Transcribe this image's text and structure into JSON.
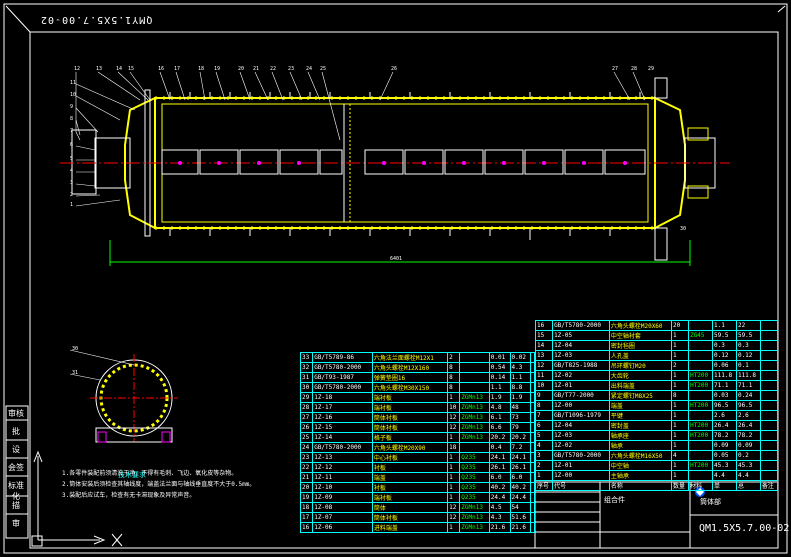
{
  "frame": {
    "title_rotated": "QMY1.5X5.7.00-02"
  },
  "side_labels": [
    "审核",
    "批",
    "设",
    "会签",
    "标准化",
    "描",
    "审"
  ],
  "main_view": {
    "overall_length_label": "6401"
  },
  "callouts_top": [
    "12",
    "13",
    "14",
    "15",
    "16",
    "17",
    "18",
    "19",
    "20",
    "21",
    "22",
    "23",
    "24",
    "25",
    "26",
    "27",
    "28",
    "29"
  ],
  "callouts_left": [
    "11",
    "10",
    "9",
    "8",
    "7",
    "6",
    "5",
    "4",
    "3",
    "2",
    "1"
  ],
  "section_callouts": [
    "30",
    "31"
  ],
  "right_callouts": [
    "28",
    "29",
    "30"
  ],
  "notes": {
    "title": "技术要求",
    "lines": [
      "1.各零件装配前须清洗干净，不得有毛刺、飞边、氧化皮等杂物。",
      "2.筒体安装后须检查其轴线度，端盖法兰面与轴线垂直度不大于0.5mm。",
      "3.装配后应试车，检查有无卡滞现象及异常声音。"
    ]
  },
  "parts_table_mid": {
    "rows": [
      [
        "33",
        "GB/T5789-86",
        "六角法兰面螺栓M12X1",
        "2",
        "",
        "0.01",
        "0.02",
        ""
      ],
      [
        "32",
        "GB/T5780-2000",
        "六角头螺栓M12X160",
        "8",
        "",
        "0.54",
        "4.3",
        ""
      ],
      [
        "31",
        "GB/T93-1987",
        "弹簧垫圈16",
        "8",
        "",
        "0.14",
        "1.1",
        ""
      ],
      [
        "30",
        "GB/T5780-2000",
        "六角头螺栓M30X150",
        "8",
        "",
        "1.1",
        "8.8",
        ""
      ],
      [
        "29",
        "1Z-18",
        "端衬板",
        "1",
        "ZGMn13",
        "1.9",
        "1.9",
        ""
      ],
      [
        "28",
        "1Z-17",
        "端衬板",
        "10",
        "ZGMn13",
        "4.8",
        "48",
        ""
      ],
      [
        "27",
        "1Z-16",
        "筒体衬板",
        "12",
        "ZGMn13",
        "6.1",
        "73",
        ""
      ],
      [
        "26",
        "1Z-15",
        "筒体衬板",
        "12",
        "ZGMn13",
        "6.6",
        "79",
        ""
      ],
      [
        "25",
        "1Z-14",
        "格子板",
        "1",
        "ZGMn13",
        "20.2",
        "20.2",
        ""
      ],
      [
        "24",
        "GB/T5780-2000",
        "六角头螺栓M20X90",
        "18",
        "",
        "0.4",
        "7.2",
        ""
      ],
      [
        "23",
        "1Z-13",
        "中心衬板",
        "1",
        "Q235",
        "24.1",
        "24.1",
        ""
      ],
      [
        "22",
        "1Z-12",
        "衬板",
        "1",
        "Q235",
        "26.1",
        "26.1",
        ""
      ],
      [
        "21",
        "1Z-11",
        "端盖",
        "1",
        "Q235",
        "6.0",
        "6.0",
        ""
      ],
      [
        "20",
        "1Z-10",
        "衬板",
        "1",
        "Q235",
        "40.2",
        "40.2",
        ""
      ],
      [
        "19",
        "1Z-09",
        "端衬板",
        "1",
        "Q235",
        "24.4",
        "24.4",
        ""
      ],
      [
        "18",
        "1Z-08",
        "筒体",
        "12",
        "ZGMn13",
        "4.5",
        "54",
        ""
      ],
      [
        "17",
        "1Z-07",
        "筒体衬板",
        "12",
        "ZGMn13",
        "4.3",
        "51.6",
        ""
      ],
      [
        "16",
        "1Z-06",
        "进料端盖",
        "1",
        "ZGMn13",
        "21.6",
        "21.6",
        ""
      ]
    ]
  },
  "parts_table_right": {
    "rows": [
      [
        "16",
        "GB/T5780-2000",
        "六角头螺栓M20X60",
        "20",
        "",
        "1.1",
        "22",
        ""
      ],
      [
        "15",
        "1Z-05",
        "中空轴衬套",
        "1",
        "ZG45",
        "59.5",
        "59.5",
        ""
      ],
      [
        "14",
        "1Z-04",
        "密封毡圈",
        "1",
        "",
        "0.3",
        "0.3",
        ""
      ],
      [
        "13",
        "1Z-03",
        "人孔盖",
        "1",
        "",
        "0.12",
        "0.12",
        ""
      ],
      [
        "12",
        "GB/T825-1988",
        "吊环螺钉M20",
        "2",
        "",
        "0.06",
        "0.1",
        ""
      ],
      [
        "11",
        "1Z-02",
        "大齿轮",
        "1",
        "HT200",
        "111.8",
        "111.8",
        ""
      ],
      [
        "10",
        "1Z-01",
        "出料端盖",
        "1",
        "HT200",
        "71.1",
        "71.1",
        ""
      ],
      [
        "9",
        "GB/T77-2000",
        "紧定螺钉M8X25",
        "8",
        "",
        "0.03",
        "0.24",
        ""
      ],
      [
        "8",
        "1Z-00",
        "端盖",
        "1",
        "HT200",
        "96.5",
        "96.5",
        ""
      ],
      [
        "7",
        "GB/T1096-1979",
        "平键",
        "1",
        "",
        "2.6",
        "2.6",
        ""
      ],
      [
        "6",
        "1Z-04",
        "密封盖",
        "1",
        "HT200",
        "26.4",
        "26.4",
        ""
      ],
      [
        "5",
        "1Z-03",
        "轴承座",
        "1",
        "HT200",
        "78.2",
        "78.2",
        ""
      ],
      [
        "4",
        "1Z-02",
        "轴承",
        "1",
        "",
        "0.09",
        "0.09",
        ""
      ],
      [
        "3",
        "GB/T5780-2000",
        "六角头螺栓M16X50",
        "4",
        "",
        "0.05",
        "0.2",
        ""
      ],
      [
        "2",
        "1Z-01",
        "中空轴",
        "1",
        "HT200",
        "45.3",
        "45.3",
        ""
      ],
      [
        "1",
        "1Z-00",
        "主轴承",
        "1",
        "",
        "4.4",
        "4.4",
        ""
      ]
    ],
    "header": [
      "序号",
      "代号",
      "名称",
      "数量",
      "材料",
      "单",
      "总",
      "备注"
    ]
  },
  "title_block": {
    "material_label": "组合件",
    "drawing_name": "筒体部",
    "drawing_no": "QM1.5X5.7.00-02"
  },
  "colors": {
    "background": "#000000",
    "outline": "#ffffff",
    "shell": "#ffff00",
    "center": "#ff0000",
    "grate": "#ff00ff",
    "table_grid": "#00ffff",
    "dims": "#00ff00"
  }
}
